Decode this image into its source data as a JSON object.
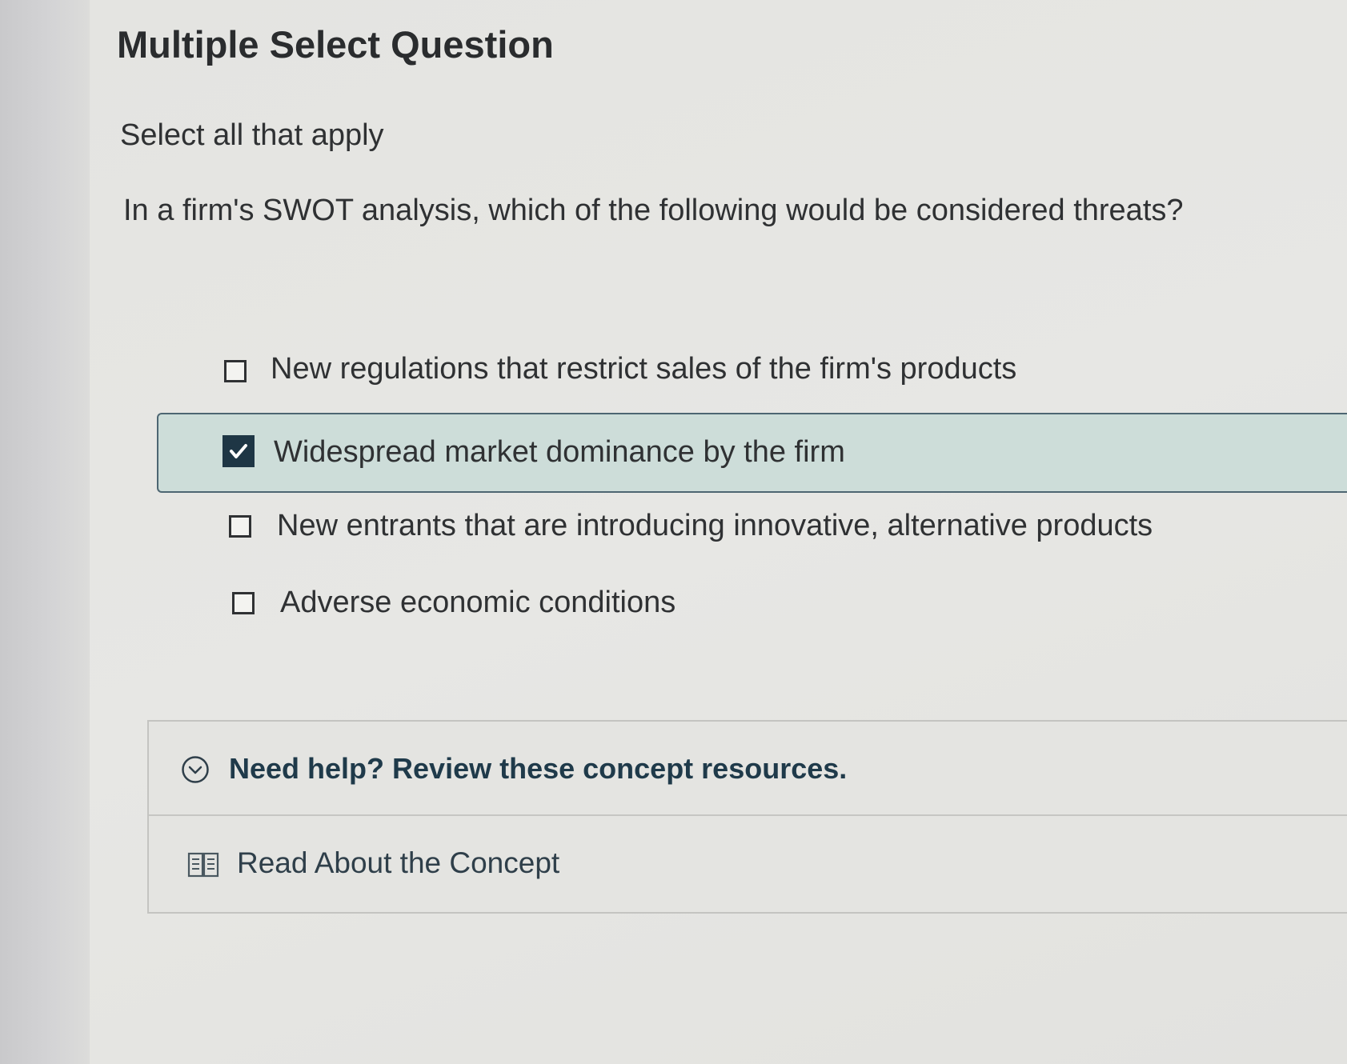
{
  "question_type": "Multiple Select Question",
  "instruction": "Select all that apply",
  "question_text": "In a firm's SWOT analysis, which of the following would be considered threats?",
  "options": [
    {
      "label": "New regulations that restrict sales of the firm's products",
      "checked": false
    },
    {
      "label": "Widespread market dominance by the firm",
      "checked": true
    },
    {
      "label": "New entrants that are introducing innovative, alternative products",
      "checked": false
    },
    {
      "label": "Adverse economic conditions",
      "checked": false
    }
  ],
  "help": {
    "header_text": "Need help? Review these concept resources.",
    "header_icon": "chevron-circle-icon",
    "resources": [
      {
        "label": "Read About the Concept",
        "icon": "book-icon"
      }
    ]
  },
  "colors": {
    "selected_background": "#cdddd9",
    "selected_border": "#4d6672",
    "checkbox_checked": "#1e3645",
    "help_text": "#1f3a4a"
  }
}
